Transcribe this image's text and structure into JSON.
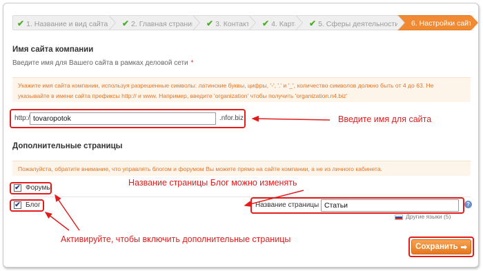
{
  "steps": [
    {
      "label": "1. Название и вид сайта",
      "done": true
    },
    {
      "label": "2. Главная страница",
      "done": true
    },
    {
      "label": "3. Контакты",
      "done": true
    },
    {
      "label": "4. Карта",
      "done": true
    },
    {
      "label": "5. Сферы деятельности",
      "done": true
    },
    {
      "label": "6. Настройки сайта",
      "done": false
    }
  ],
  "step_check": "✔",
  "site_name": {
    "title": "Имя сайта компании",
    "label": "Введите имя для Вашего сайта в рамках деловой сети",
    "required_mark": "*",
    "note_line1": "Укажите имя сайта компании, используя разрешенные символы: латинские буквы, цифры, '-', '.' и '_', количество символов должно быть от 4 до 63. Не",
    "note_line2": "указывайте в имени сайта префиксы http:// и www. Например, введите 'organization' чтобы получить 'organization.n4.biz'",
    "prefix": "http://",
    "value": "tovaropotok",
    "suffix": ".nfor.biz"
  },
  "extra_pages": {
    "title": "Дополнительные страницы",
    "note": "Пожалуйста, обратите внимание, что управлять блогом и форумом Вы можете прямо на сайте компании, а не из личного кабинета.",
    "forums_label": "Форумы",
    "blog_label": "Блог",
    "page_name_label": "Название страницы",
    "page_name_value": "Статьи",
    "other_languages": "Другие языки (5)"
  },
  "check_mark": "✔",
  "help_icon": "?",
  "save_label": "Сохранить",
  "save_arrow": "➡",
  "annotations": {
    "enter_name": "Введите имя для сайта",
    "rename_blog": "Название страницы Блог можно изменять",
    "activate": "Активируйте, чтобы включить дополнительные страницы"
  },
  "colors": {
    "accent": "#f08a33",
    "annotation": "#e21b1b",
    "check": "#4caf2a",
    "note_text": "#e0752a"
  }
}
